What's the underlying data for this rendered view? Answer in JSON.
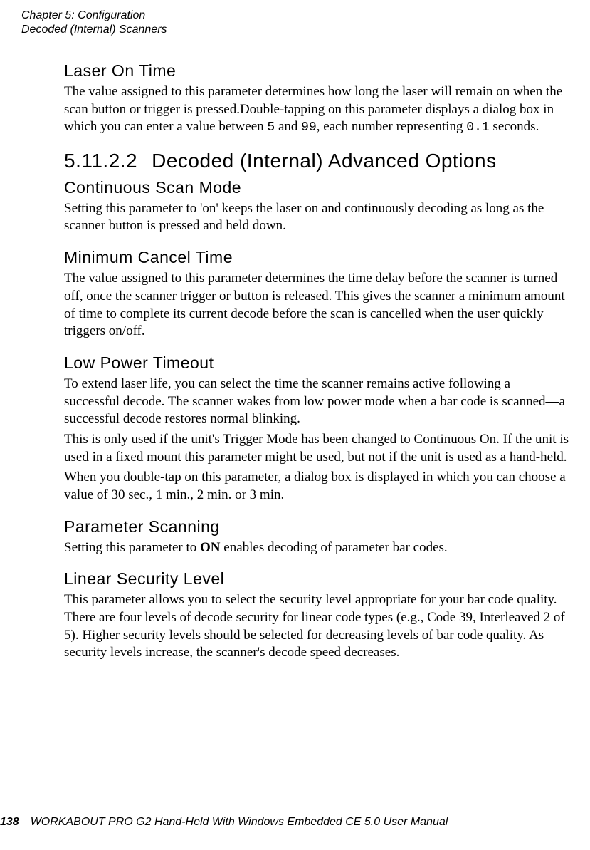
{
  "runningHead": {
    "chapter": "Chapter 5: Configuration",
    "section": "Decoded (Internal) Scanners"
  },
  "sections": {
    "laserOnTime": {
      "title": "Laser On Time",
      "p1a": "The value assigned to this parameter determines how long the laser will remain on when the scan button or trigger is pressed.Double-tapping on this parameter displays a dialog box in which you can enter a value between ",
      "v1": "5",
      "p1b": " and ",
      "v2": "99",
      "p1c": ", each number representing ",
      "v3": "0.1",
      "p1d": " seconds."
    },
    "advanced": {
      "number": "5.11.2.2",
      "title": "Decoded (Internal) Advanced Options"
    },
    "continuous": {
      "title": "Continuous Scan Mode",
      "body": "Setting this parameter to 'on' keeps the laser on and continuously decoding as long as the scanner button is pressed and held down."
    },
    "minCancel": {
      "title": "Minimum Cancel Time",
      "body": "The value assigned to this parameter determines the time delay before the scanner is turned off, once the scanner trigger or button is released. This gives the scanner a minimum amount of time to complete its current decode before the scan is cancelled when the user quickly triggers on/off."
    },
    "lowPower": {
      "title": "Low Power Timeout",
      "p1": "To extend laser life, you can select the time the scanner remains active following a successful decode. The scanner wakes from low power mode when a bar code is scanned—a successful decode restores normal blinking.",
      "p2": "This is only used if the unit's Trigger Mode has been changed to Continuous On. If the unit is used in a fixed mount this parameter might be used, but not if the unit is used as a hand-held.",
      "p3": "When you double-tap on this parameter, a dialog box is displayed in which you can choose a value of 30 sec., 1 min., 2 min. or 3 min."
    },
    "paramScan": {
      "title": "Parameter Scanning",
      "p1a": "Setting this parameter to ",
      "bold": "ON",
      "p1b": " enables decoding of parameter bar codes."
    },
    "linear": {
      "title": "Linear Security Level",
      "body": "This parameter allows you to select the security level appropriate for your bar code quality. There are four levels of decode security for linear code types (e.g., Code 39, Interleaved 2 of 5). Higher security levels should be selected for decreasing levels of bar code quality. As security levels increase, the scanner's decode speed decreases."
    }
  },
  "footer": {
    "page": "138",
    "text": "WORKABOUT PRO G2 Hand-Held With Windows Embedded CE 5.0 User Manual"
  }
}
